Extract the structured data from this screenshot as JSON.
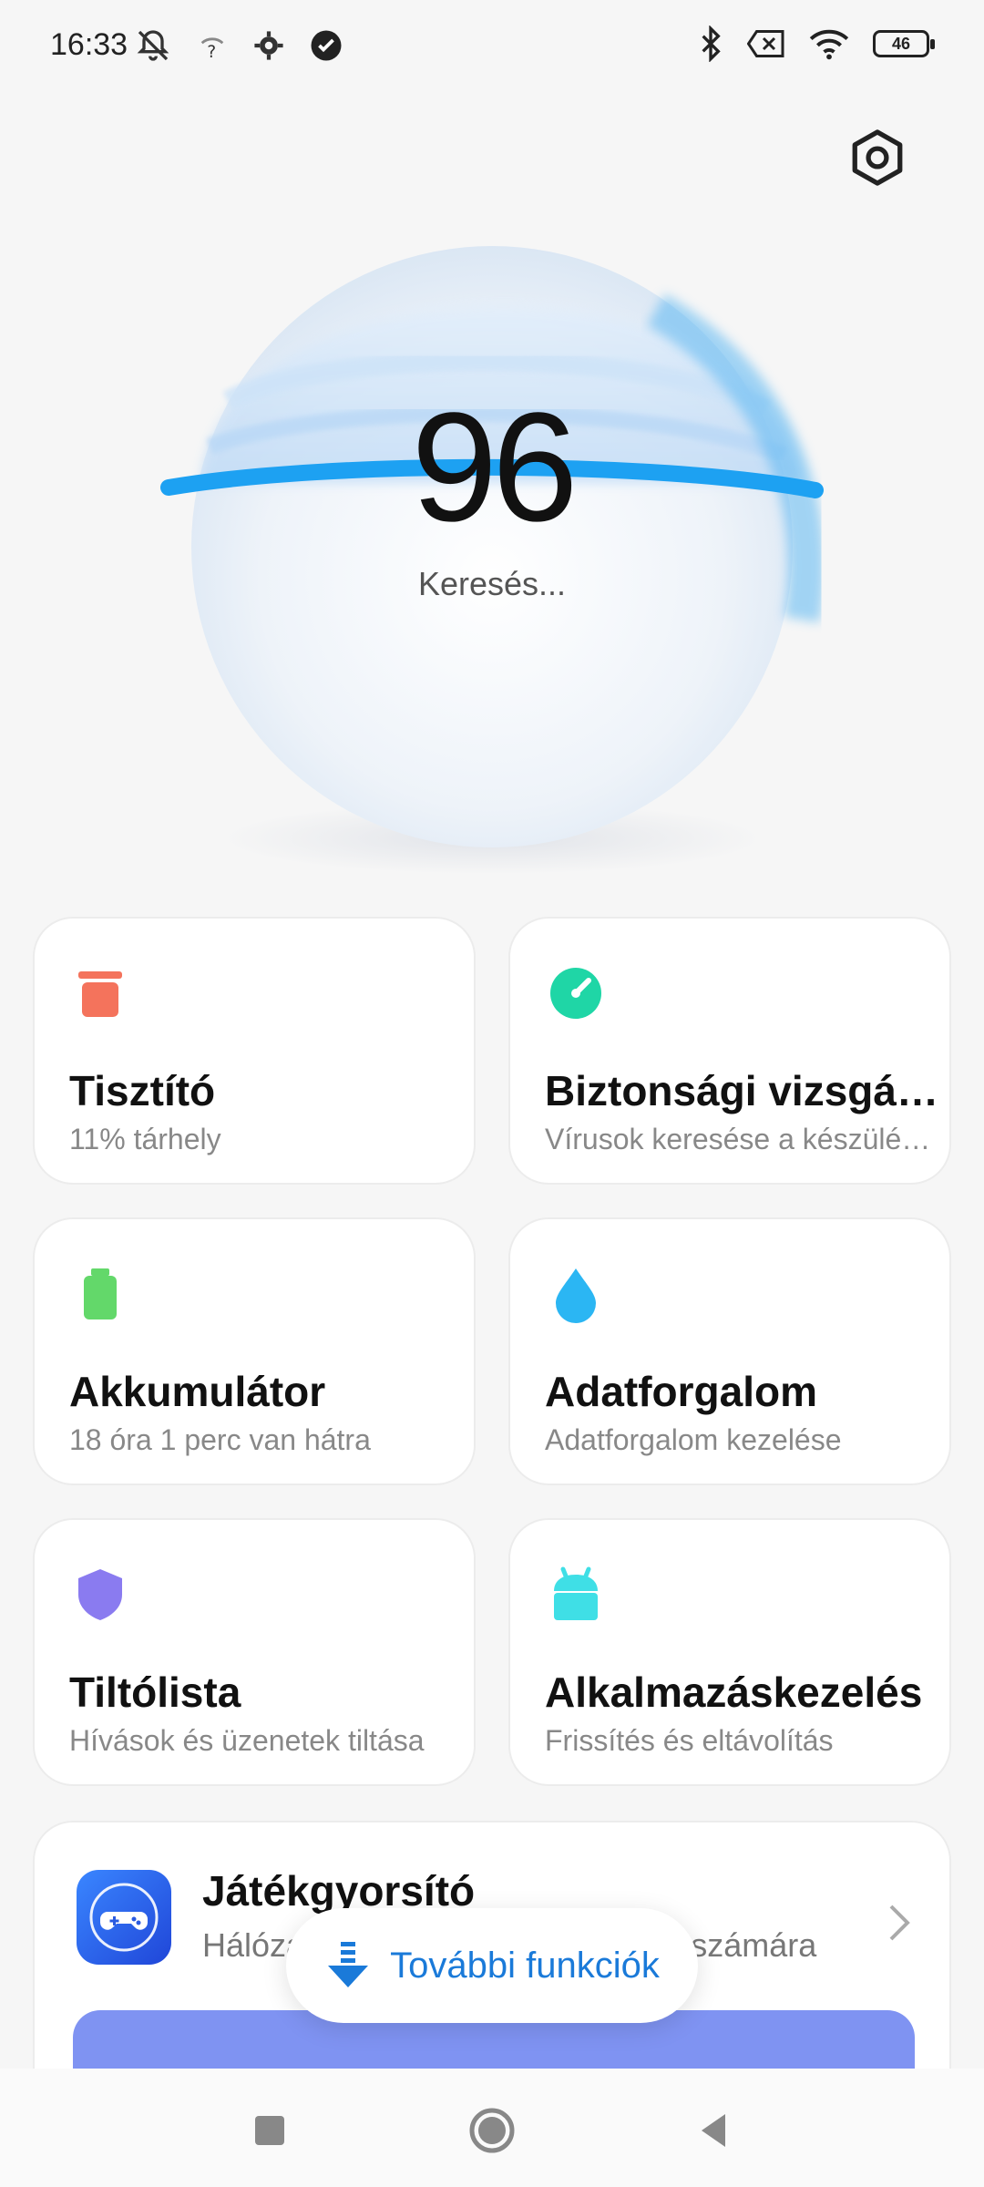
{
  "status_bar": {
    "time": "16:33",
    "icons_left": [
      "muted-bell-icon",
      "wifi-question-icon",
      "gear-icon",
      "check-circle-icon"
    ],
    "icons_right": [
      "bluetooth-icon",
      "no-sim-icon",
      "wifi-icon",
      "battery-icon"
    ],
    "battery_level": "46"
  },
  "header": {
    "settings_icon": "hexagon-settings-icon"
  },
  "scan": {
    "score": "96",
    "status": "Keresés..."
  },
  "cards": [
    {
      "title": "Tisztító",
      "subtitle": "11% tárhely",
      "icon": "trash-icon",
      "color": "#f4735c"
    },
    {
      "title": "Biztonsági vizsgálat",
      "subtitle": "Vírusok keresése a készüléken",
      "icon": "speedometer-icon",
      "color": "#1fd6a6"
    },
    {
      "title": "Akkumulátor",
      "subtitle": "18 óra 1 perc  van hátra",
      "icon": "battery-card-icon",
      "color": "#63d86a"
    },
    {
      "title": "Adatforgalom",
      "subtitle": "Adatforgalom kezelése",
      "icon": "droplet-icon",
      "color": "#2bb6f3"
    },
    {
      "title": "Tiltólista",
      "subtitle": "Hívások és üzenetek tiltása",
      "icon": "shield-icon",
      "color": "#8a7bf0"
    },
    {
      "title": "Alkalmazáskezelés",
      "subtitle": "Frissítés és eltávolítás",
      "icon": "android-icon",
      "color": "#3fdfe6"
    }
  ],
  "game_booster": {
    "title": "Játékgyorsító",
    "subtitle": "Hálózat és teljesítmény a játékok számára",
    "icon": "gamepad-icon"
  },
  "more_button": {
    "label": "További funkciók",
    "icon": "download-arrow-icon"
  },
  "nav": [
    "recents-icon",
    "home-icon",
    "back-icon"
  ],
  "colors": {
    "accent": "#1a7ad9",
    "orb_ring": "#1da1f2",
    "game_bar": "#7f93f2"
  }
}
